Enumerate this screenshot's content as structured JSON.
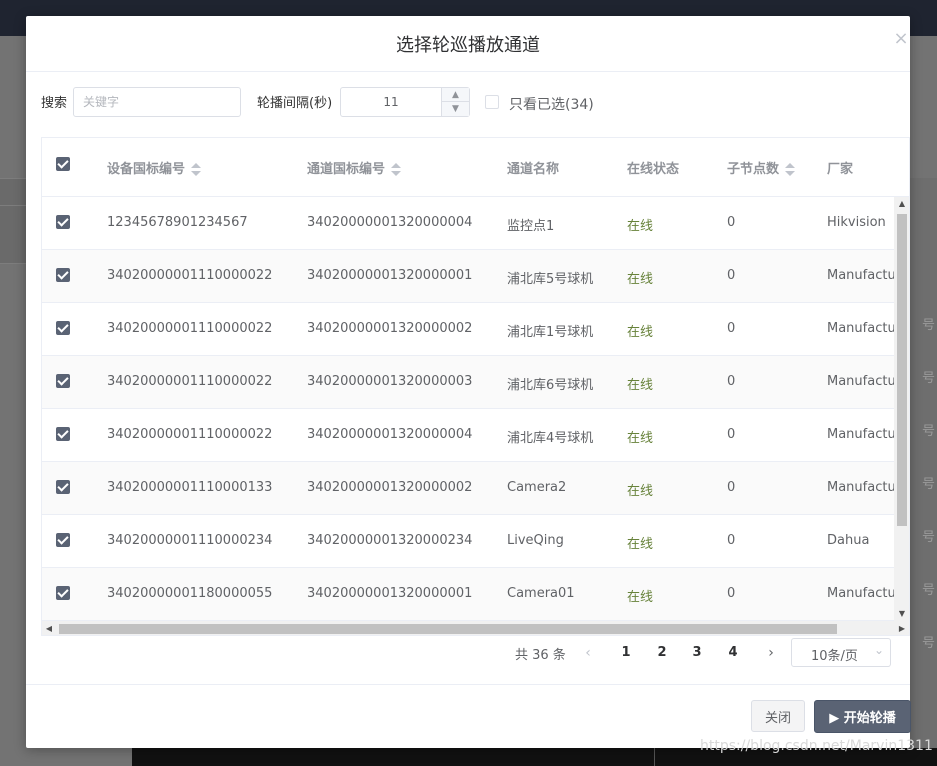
{
  "background": {
    "side_text": "号"
  },
  "dialog": {
    "title": "选择轮巡播放通道",
    "close_glyph": "×"
  },
  "toolbar": {
    "search_label": "搜索",
    "search_placeholder": "关键字",
    "interval_label": "轮播间隔(秒)",
    "interval_value": "11",
    "only_checked_label": "只看已选(34)"
  },
  "table": {
    "columns": [
      "设备国标编号",
      "通道国标编号",
      "通道名称",
      "在线状态",
      "子节点数",
      "厂家"
    ],
    "rows": [
      {
        "device": "12345678901234567",
        "channel": "34020000001320000004",
        "name": "监控点1",
        "status": "在线",
        "children": "0",
        "vendor": "Hikvision"
      },
      {
        "device": "34020000001110000022",
        "channel": "34020000001320000001",
        "name": "浦北库5号球机",
        "status": "在线",
        "children": "0",
        "vendor": "Manufacturer"
      },
      {
        "device": "34020000001110000022",
        "channel": "34020000001320000002",
        "name": "浦北库1号球机",
        "status": "在线",
        "children": "0",
        "vendor": "Manufacturer"
      },
      {
        "device": "34020000001110000022",
        "channel": "34020000001320000003",
        "name": "浦北库6号球机",
        "status": "在线",
        "children": "0",
        "vendor": "Manufacturer"
      },
      {
        "device": "34020000001110000022",
        "channel": "34020000001320000004",
        "name": "浦北库4号球机",
        "status": "在线",
        "children": "0",
        "vendor": "Manufacturer"
      },
      {
        "device": "34020000001110000133",
        "channel": "34020000001320000002",
        "name": "Camera2",
        "status": "在线",
        "children": "0",
        "vendor": "Manufacturer"
      },
      {
        "device": "34020000001110000234",
        "channel": "34020000001320000234",
        "name": "LiveQing",
        "status": "在线",
        "children": "0",
        "vendor": "Dahua"
      },
      {
        "device": "34020000001180000055",
        "channel": "34020000001320000001",
        "name": "Camera01",
        "status": "在线",
        "children": "0",
        "vendor": "Manufacturer"
      }
    ]
  },
  "pagination": {
    "total": "共 36 条",
    "pages": [
      "1",
      "2",
      "3",
      "4"
    ],
    "current": "2",
    "page_size": "10条/页"
  },
  "footer": {
    "close_label": "关闭",
    "start_label": "▶ 开始轮播"
  },
  "watermark": "https://blog.csdn.net/Marvin1311",
  "colors": {
    "primary": "#5a6374",
    "online": "#67823a"
  }
}
